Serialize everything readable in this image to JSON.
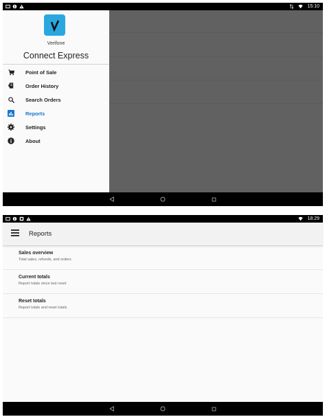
{
  "screen1": {
    "status": {
      "time": "15:10"
    },
    "drawer": {
      "brand": "Verifone",
      "product": "Connect Express",
      "items": [
        {
          "label": "Point of Sale",
          "icon": "cart-icon"
        },
        {
          "label": "Order History",
          "icon": "receipt-icon"
        },
        {
          "label": "Search Orders",
          "icon": "search-icon"
        },
        {
          "label": "Reports",
          "icon": "chart-icon",
          "active": true
        },
        {
          "label": "Settings",
          "icon": "gear-icon"
        },
        {
          "label": "About",
          "icon": "info-icon"
        }
      ]
    }
  },
  "screen2": {
    "status": {
      "time": "18:29"
    },
    "title": "Reports",
    "rows": [
      {
        "title": "Sales overview",
        "subtitle": "Total sales, refunds, and orders"
      },
      {
        "title": "Current totals",
        "subtitle": "Report totals since last reset"
      },
      {
        "title": "Reset totals",
        "subtitle": "Report totals and reset totals"
      }
    ]
  },
  "colors": {
    "accent": "#1976d2",
    "logo": "#2aa7df",
    "scrim": "#616161"
  }
}
